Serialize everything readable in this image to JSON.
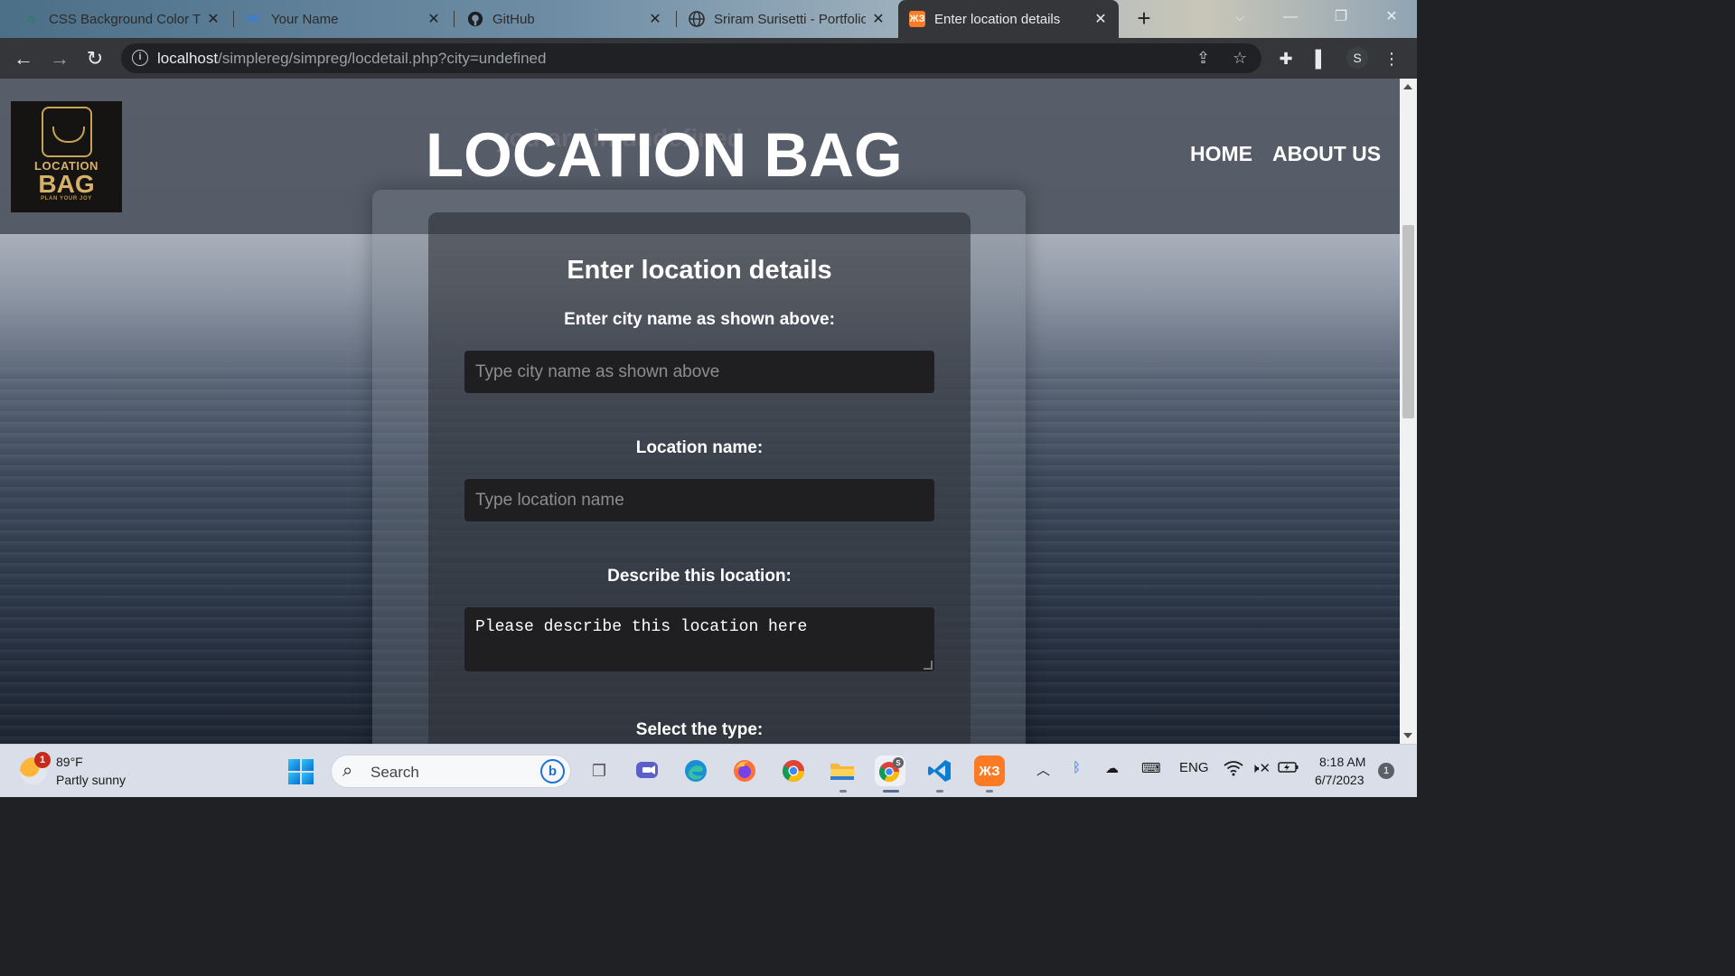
{
  "browser": {
    "tabs": [
      {
        "title": "CSS Background Color Tra",
        "icon": "chatgpt-icon"
      },
      {
        "title": "Your Name",
        "icon": "me-icon",
        "icon_text": "ME"
      },
      {
        "title": "GitHub",
        "icon": "github-icon"
      },
      {
        "title": "Sriram Surisetti - Portfolio",
        "icon": "globe-icon"
      },
      {
        "title": "Enter location details",
        "icon": "xampp-icon",
        "active": true
      }
    ],
    "new_tab": "+",
    "address": {
      "host": "localhost",
      "path": "/simplereg/simpreg/locdetail.php?city=undefined"
    },
    "profile_initial": "S"
  },
  "page": {
    "logo": {
      "line1": "LOCATION",
      "line2": "BAG",
      "tagline": "PLAN YOUR JOY"
    },
    "ghost_text": "you are in undefined",
    "site_title": "LOCATION BAG",
    "nav": [
      {
        "label": "HOME"
      },
      {
        "label": "ABOUT US"
      }
    ],
    "form": {
      "title": "Enter location details",
      "city_label": "Enter city name as shown above:",
      "city_placeholder": "Type city name as shown above",
      "location_label": "Location name:",
      "location_placeholder": "Type location name",
      "describe_label": "Describe this location:",
      "describe_placeholder": "Please describe this location here",
      "type_label": "Select the type:"
    }
  },
  "taskbar": {
    "weather": {
      "badge": "1",
      "temp": "89°F",
      "desc": "Partly sunny"
    },
    "search_label": "Search",
    "language": "ENG",
    "time": "8:18 AM",
    "date": "6/7/2023",
    "notifications": "1"
  },
  "colors": {
    "accent_tab": "#35363a",
    "taskbar": "#d9dee8",
    "form_input": "#1f1f21",
    "logo_gold": "#d6b06a"
  }
}
